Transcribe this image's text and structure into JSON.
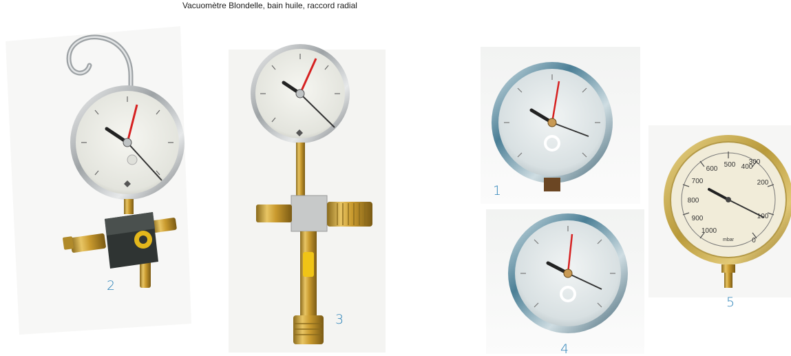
{
  "caption": "Vacuomètre Blondelle, bain huile, raccord radial",
  "label_color": "#2b82b8",
  "gauges": [
    {
      "number": "1"
    },
    {
      "number": "2"
    },
    {
      "number": "3"
    },
    {
      "number": "4"
    },
    {
      "number": "5"
    }
  ],
  "gauge5_scale": {
    "ticks": [
      "0",
      "100",
      "200",
      "300",
      "400",
      "500",
      "600",
      "700",
      "800",
      "900",
      "1000"
    ],
    "unit": "mbar"
  }
}
